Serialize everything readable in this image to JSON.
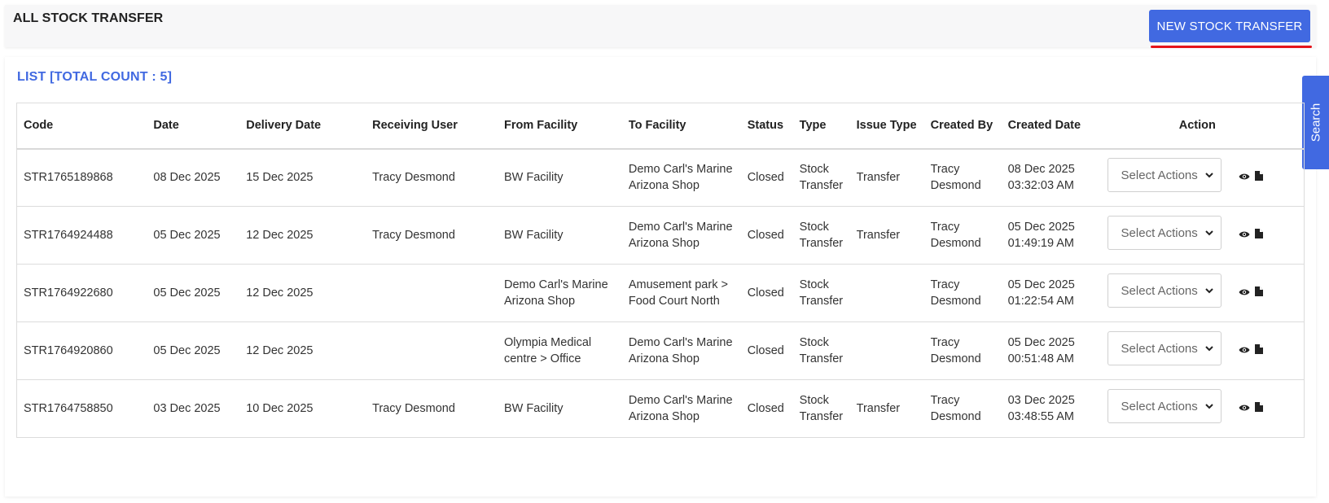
{
  "header": {
    "title": "ALL STOCK TRANSFER",
    "new_button_label": "NEW STOCK TRANSFER",
    "underline_color": "#e4131b"
  },
  "list": {
    "title": "LIST [TOTAL COUNT : 5]"
  },
  "search_tab": {
    "label": "Search"
  },
  "colors": {
    "accent": "#4169e1"
  },
  "table": {
    "headers": {
      "code": "Code",
      "date": "Date",
      "delivery_date": "Delivery Date",
      "receiving_user": "Receiving User",
      "from_facility": "From Facility",
      "to_facility": "To Facility",
      "status": "Status",
      "type": "Type",
      "issue_type": "Issue Type",
      "created_by": "Created By",
      "created_date": "Created Date",
      "action": "Action"
    },
    "action_placeholder": "Select Actions",
    "icons": [
      "eye-icon",
      "document-icon"
    ],
    "rows": [
      {
        "code": "STR1765189868",
        "date": "08 Dec 2025",
        "delivery_date": "15 Dec 2025",
        "receiving_user": "Tracy Desmond",
        "from_1": "BW Facility",
        "from_2": "",
        "to_1": "Demo Carl's Marine",
        "to_2": "Arizona Shop",
        "status": "Closed",
        "type_1": "Stock",
        "type_2": "Transfer",
        "issue_type": "Transfer",
        "created_by_1": "Tracy",
        "created_by_2": "Desmond",
        "created_date_1": "08 Dec 2025",
        "created_date_2": "03:32:03 AM"
      },
      {
        "code": "STR1764924488",
        "date": "05 Dec 2025",
        "delivery_date": "12 Dec 2025",
        "receiving_user": "Tracy Desmond",
        "from_1": "BW Facility",
        "from_2": "",
        "to_1": "Demo Carl's Marine",
        "to_2": "Arizona Shop",
        "status": "Closed",
        "type_1": "Stock",
        "type_2": "Transfer",
        "issue_type": "Transfer",
        "created_by_1": "Tracy",
        "created_by_2": "Desmond",
        "created_date_1": "05 Dec 2025",
        "created_date_2": "01:49:19 AM"
      },
      {
        "code": "STR1764922680",
        "date": "05 Dec 2025",
        "delivery_date": "12 Dec 2025",
        "receiving_user": "",
        "from_1": "Demo Carl's Marine",
        "from_2": "Arizona Shop",
        "to_1": "Amusement park >",
        "to_2": "Food Court North",
        "status": "Closed",
        "type_1": "Stock",
        "type_2": "Transfer",
        "issue_type": "",
        "created_by_1": "Tracy",
        "created_by_2": "Desmond",
        "created_date_1": "05 Dec 2025",
        "created_date_2": "01:22:54 AM"
      },
      {
        "code": "STR1764920860",
        "date": "05 Dec 2025",
        "delivery_date": "12 Dec 2025",
        "receiving_user": "",
        "from_1": "Olympia Medical",
        "from_2": "centre > Office",
        "to_1": "Demo Carl's Marine",
        "to_2": "Arizona Shop",
        "status": "Closed",
        "type_1": "Stock",
        "type_2": "Transfer",
        "issue_type": "",
        "created_by_1": "Tracy",
        "created_by_2": "Desmond",
        "created_date_1": "05 Dec 2025",
        "created_date_2": "00:51:48 AM"
      },
      {
        "code": "STR1764758850",
        "date": "03 Dec 2025",
        "delivery_date": "10 Dec 2025",
        "receiving_user": "Tracy Desmond",
        "from_1": "BW Facility",
        "from_2": "",
        "to_1": "Demo Carl's Marine",
        "to_2": "Arizona Shop",
        "status": "Closed",
        "type_1": "Stock",
        "type_2": "Transfer",
        "issue_type": "Transfer",
        "created_by_1": "Tracy",
        "created_by_2": "Desmond",
        "created_date_1": "03 Dec 2025",
        "created_date_2": "03:48:55 AM"
      }
    ]
  }
}
